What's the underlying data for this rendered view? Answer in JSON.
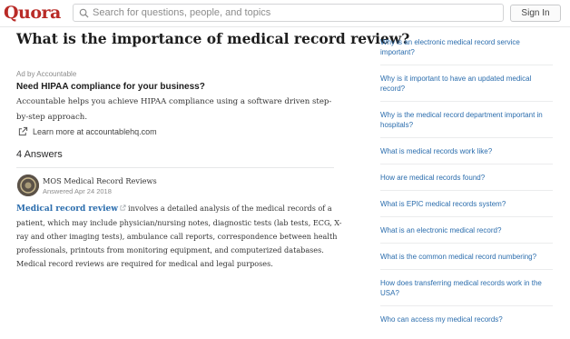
{
  "header": {
    "logo": "Quora",
    "search_placeholder": "Search for questions, people, and topics",
    "signin_label": "Sign In"
  },
  "question": {
    "title": "What is the importance of medical record review?"
  },
  "ad": {
    "label": "Ad by Accountable",
    "heading": "Need HIPAA compliance for your business?",
    "body": "Accountable helps you achieve HIPAA compliance using a software driven step-by-step approach.",
    "link": "Learn more at accountablehq.com"
  },
  "answers": {
    "count_label": "4 Answers",
    "items": [
      {
        "author": "MOS Medical Record Reviews",
        "answered": "Answered Apr 24 2018",
        "lead": "Medical record review",
        "body_rest": "involves a detailed analysis of the medical records of a patient, which may include physician/nursing notes, diagnostic tests (lab tests, ECG, X-ray and other imaging tests), ambulance call reports, correspondence between health professionals, printouts from monitoring equipment, and computerized databases. Medical record reviews are required for medical and legal purposes."
      }
    ]
  },
  "related": [
    "Why is an electronic medical record service important?",
    "Why is it important to have an updated medical record?",
    "Why is the medical record department important in hospitals?",
    "What is medical records work like?",
    "How are medical records found?",
    "What is EPIC medical records system?",
    "What is an electronic medical record?",
    "What is the common medical record numbering?",
    "How does transferring medical records work in the USA?",
    "Who can access my medical records?"
  ],
  "colors": {
    "brand": "#b92b27",
    "link": "#2b6dad"
  }
}
